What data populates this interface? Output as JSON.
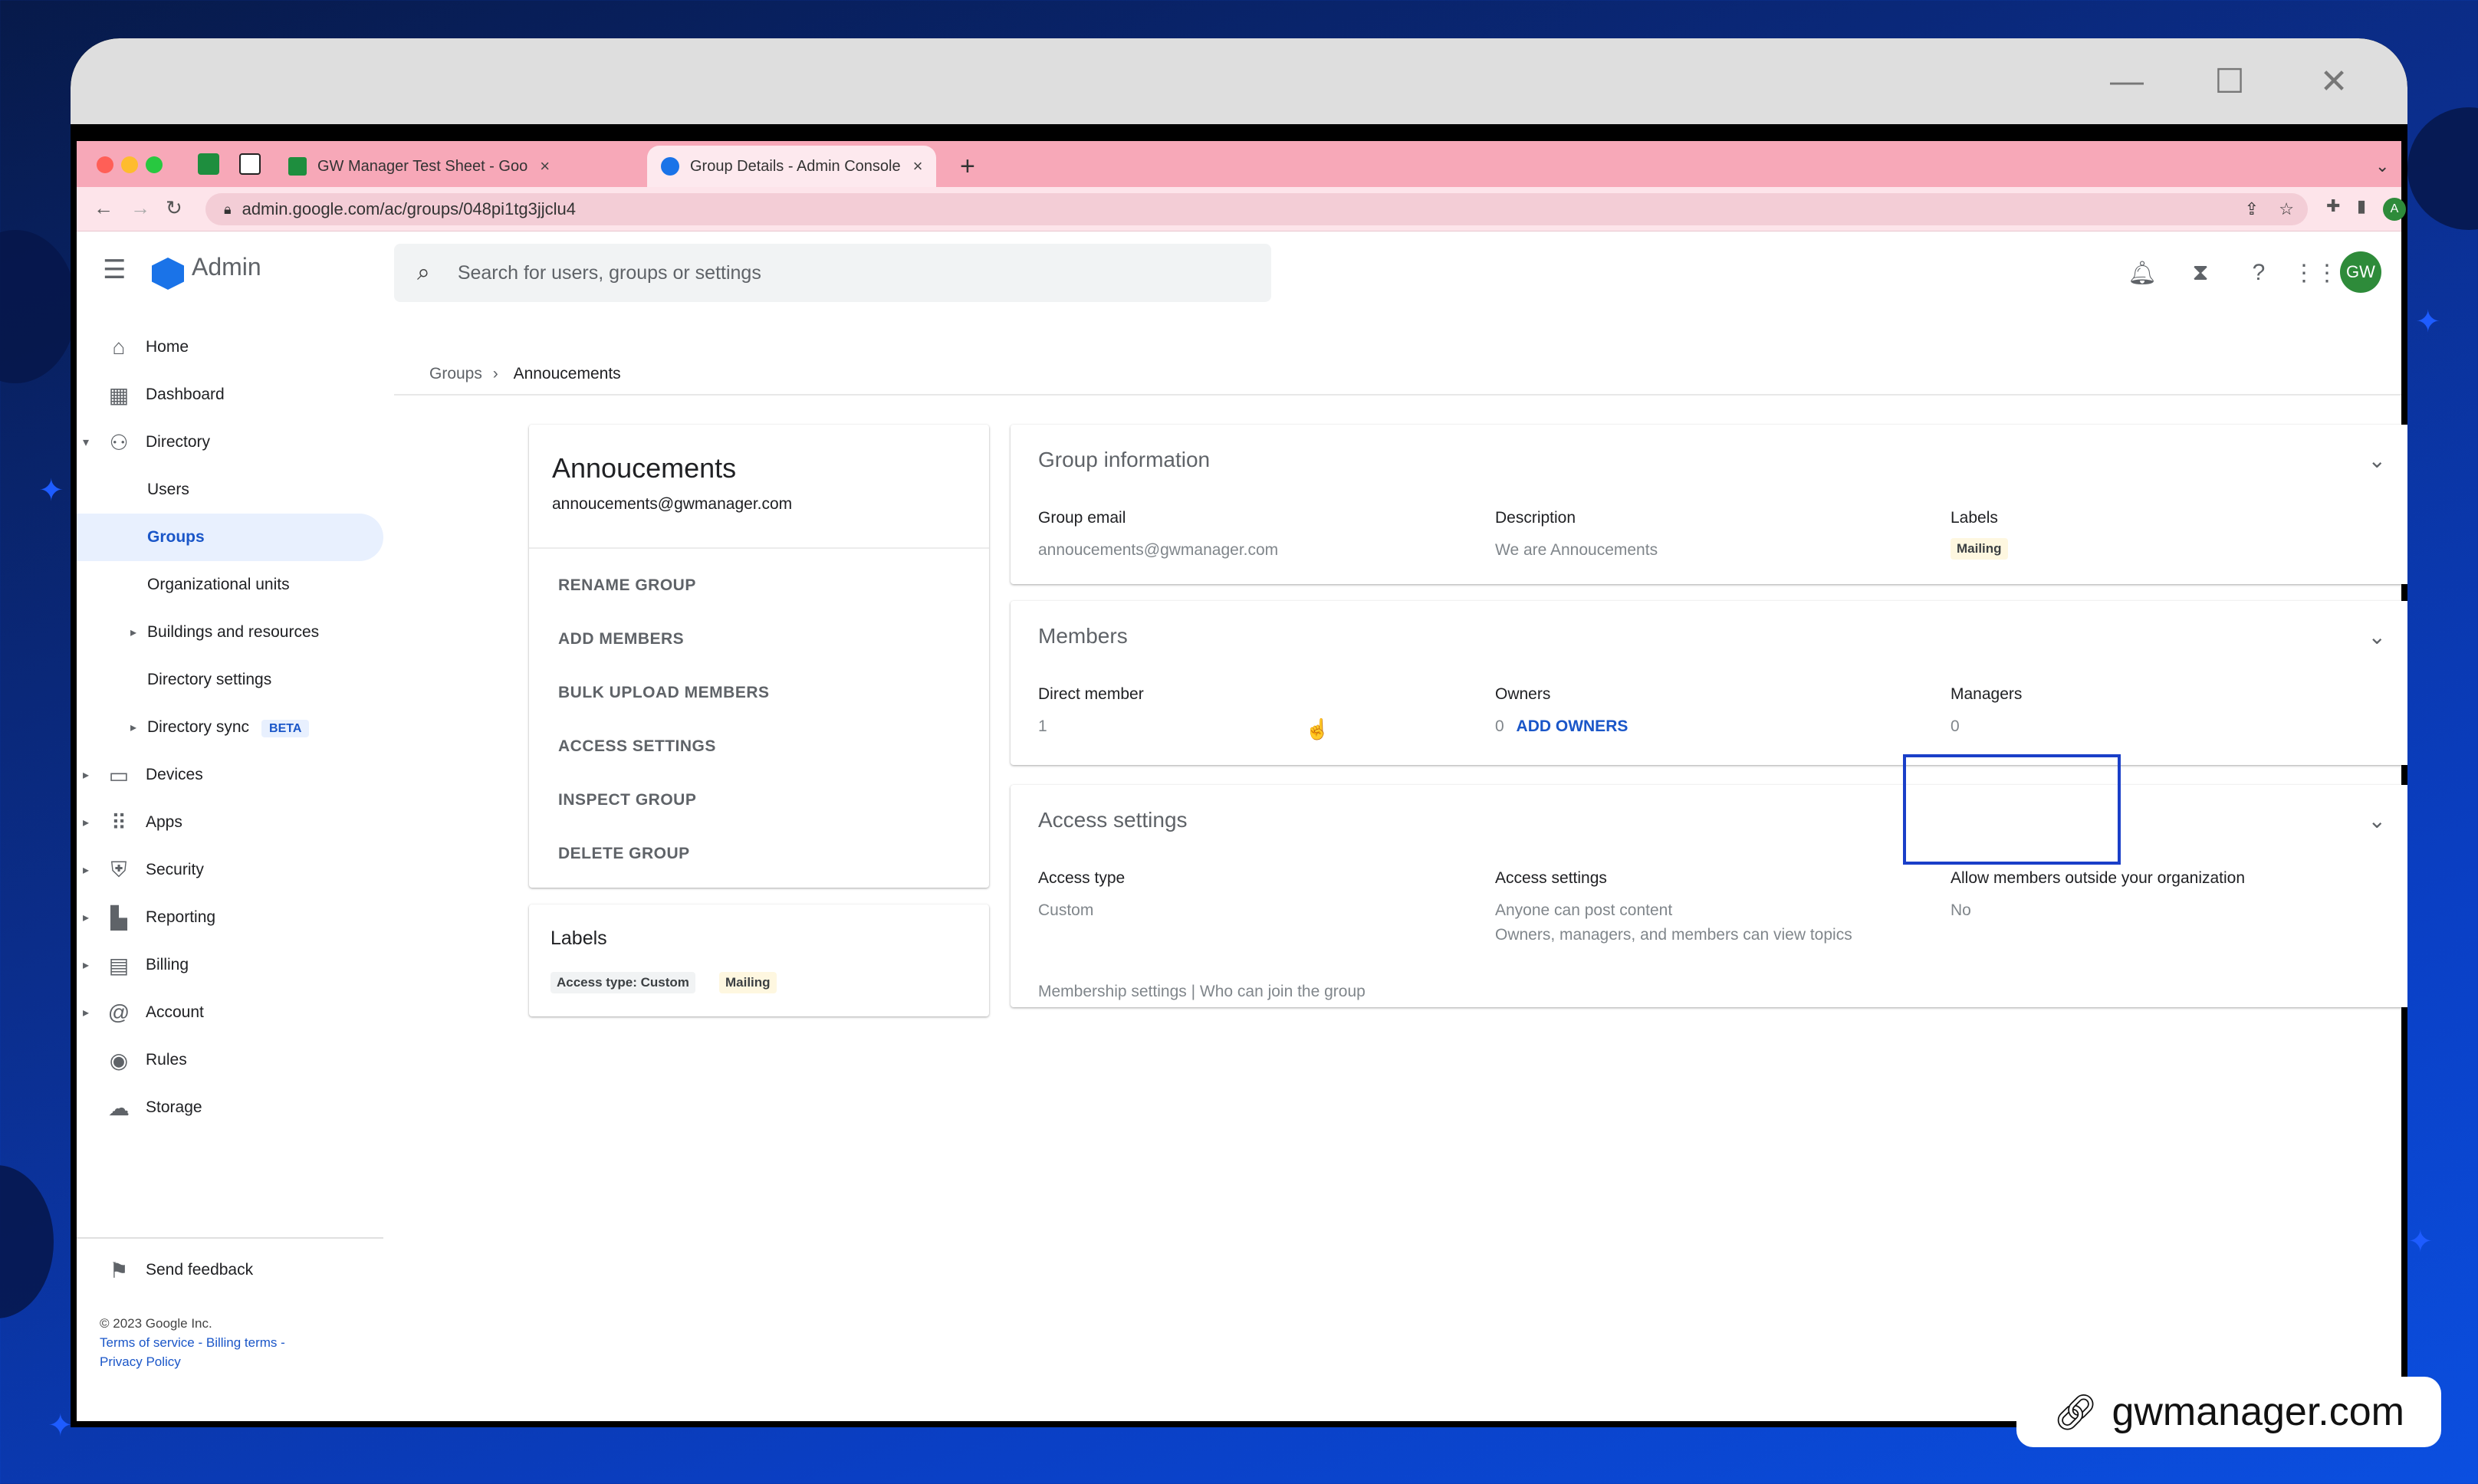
{
  "browser": {
    "tabs": [
      {
        "title": "GW Manager Test Sheet - Goo",
        "close": "×"
      },
      {
        "title": "Group Details - Admin Console",
        "close": "×"
      }
    ],
    "new_tab": "+",
    "url": "admin.google.com/ac/groups/048pi1tg3jjclu4",
    "profile_initial": "A"
  },
  "app": {
    "product": "Admin",
    "search_placeholder": "Search for users, groups or settings",
    "avatar": "GW"
  },
  "sidebar": {
    "items": [
      {
        "label": "Home",
        "icon": "home-icon"
      },
      {
        "label": "Dashboard",
        "icon": "dashboard-icon"
      },
      {
        "label": "Directory",
        "icon": "person-icon"
      },
      {
        "label": "Users"
      },
      {
        "label": "Groups"
      },
      {
        "label": "Organizational units"
      },
      {
        "label": "Buildings and resources"
      },
      {
        "label": "Directory settings"
      },
      {
        "label": "Directory sync",
        "badge": "BETA"
      },
      {
        "label": "Devices",
        "icon": "devices-icon"
      },
      {
        "label": "Apps",
        "icon": "apps-grid-icon"
      },
      {
        "label": "Security",
        "icon": "shield-icon"
      },
      {
        "label": "Reporting",
        "icon": "bar-chart-icon"
      },
      {
        "label": "Billing",
        "icon": "credit-card-icon"
      },
      {
        "label": "Account",
        "icon": "at-sign-icon"
      },
      {
        "label": "Rules",
        "icon": "rules-icon"
      },
      {
        "label": "Storage",
        "icon": "cloud-icon"
      }
    ],
    "feedback": "Send feedback",
    "copyright": "© 2023 Google Inc.",
    "terms": "Terms of service - Billing terms -",
    "privacy": "Privacy Policy"
  },
  "breadcrumb": {
    "parent": "Groups",
    "current": "Annoucements"
  },
  "group": {
    "name": "Annoucements",
    "email": "annoucements@gwmanager.com",
    "actions": [
      "RENAME GROUP",
      "ADD MEMBERS",
      "BULK UPLOAD MEMBERS",
      "ACCESS SETTINGS",
      "INSPECT GROUP",
      "DELETE GROUP"
    ]
  },
  "labels_card": {
    "title": "Labels",
    "chips": [
      "Access type: Custom",
      "Mailing"
    ]
  },
  "group_information": {
    "title": "Group information",
    "email_label": "Group email",
    "email_value": "annoucements@gwmanager.com",
    "description_label": "Description",
    "description_value": "We are Annoucements",
    "labels_label": "Labels",
    "labels_chip": "Mailing"
  },
  "members": {
    "title": "Members",
    "direct_label": "Direct member",
    "direct_value": "1",
    "owners_label": "Owners",
    "owners_value": "0",
    "add_owners": "ADD OWNERS",
    "managers_label": "Managers",
    "managers_value": "0"
  },
  "access": {
    "title": "Access settings",
    "type_label": "Access type",
    "type_value": "Custom",
    "settings_label": "Access settings",
    "settings_value_1": "Anyone can post content",
    "settings_value_2": "Owners, managers, and members can view topics",
    "outside_label": "Allow members outside your organization",
    "outside_value": "No",
    "footer": "Membership settings | Who can join the group"
  },
  "watermark": "gwmanager.com",
  "colors": {
    "accent": "#1a56c8",
    "highlight": "#1a3fc8",
    "tabstrip": "#f7a8b8"
  }
}
